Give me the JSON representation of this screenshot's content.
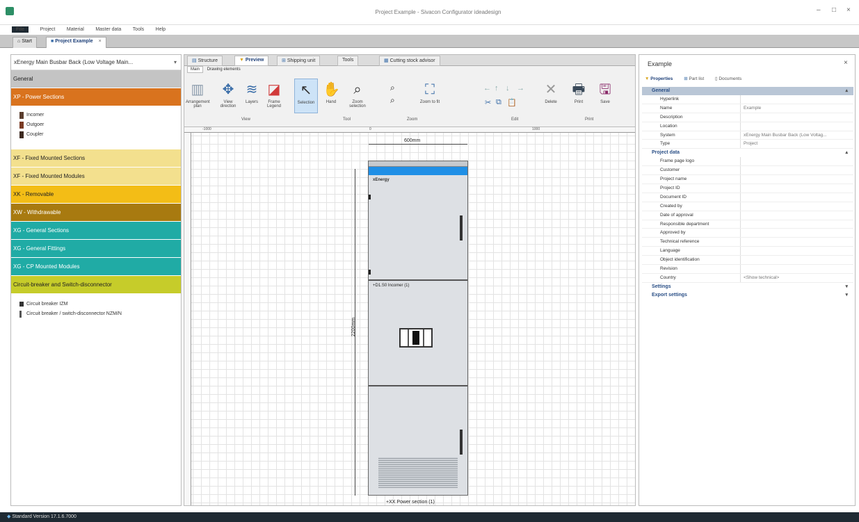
{
  "window": {
    "title": "Project Example - Sivacon Configurator ideadesign"
  },
  "menu": {
    "file": "File",
    "items": [
      "Project",
      "Material",
      "Master data",
      "Tools",
      "Help"
    ]
  },
  "tabs": {
    "start": "Start",
    "project": "Project Example"
  },
  "left": {
    "header": "xEnergy Main Busbar Back (Low Voltage Main...",
    "general": "General",
    "power_sections": "XP - Power Sections",
    "power_items": [
      "Incomer",
      "Outgoer",
      "Coupler"
    ],
    "groups": [
      {
        "label": "XF - Fixed Mounted Sections",
        "color": "#f3e08e"
      },
      {
        "label": "XF - Fixed Mounted Modules",
        "color": "#f3e08e"
      },
      {
        "label": "XK - Removable",
        "color": "#f3bd16"
      },
      {
        "label": "XW - Withdrawable",
        "color": "#a87a10"
      },
      {
        "label": "XG - General Sections",
        "color": "#20aba5"
      },
      {
        "label": "XG - General Fittings",
        "color": "#20aba5"
      },
      {
        "label": "XG - CP Mounted Modules",
        "color": "#20aba5"
      },
      {
        "label": "Circuit-breaker and Switch-disconnector",
        "color": "#c6cc2a"
      }
    ],
    "breaker_items": [
      "Circuit breaker IZM",
      "Circuit breaker / switch-disconnector NZM/N"
    ]
  },
  "center": {
    "tabs": [
      "Structure",
      "Preview",
      "Shipping unit",
      "Tools",
      "Cutting stock advisor"
    ],
    "subtabs": [
      "Main",
      "Drawing elements"
    ],
    "ribbon_buttons": [
      "Arrangement plan",
      "View direction",
      "Layers",
      "Frame Legend",
      "Selection",
      "Hand",
      "Zoom selection",
      "Zoom to fit",
      "Delete",
      "Print",
      "Save"
    ],
    "ribbon_groups": [
      "View",
      "Tool",
      "Zoom",
      "Edit",
      "Print"
    ],
    "width_label": "600mm",
    "height_label": "2200mm",
    "door_brand": "xEnergy",
    "incomer_label": "+D1.S0 Incomer (1)",
    "footer_label": "+XX Power section (1)",
    "ruler_marks": [
      "-1000",
      "0",
      "1000"
    ]
  },
  "right": {
    "title": "Example",
    "tabs": [
      "Properties",
      "Part list",
      "Documents"
    ],
    "general_title": "General",
    "general_rows": [
      {
        "key": "Hyperlink",
        "value": ""
      },
      {
        "key": "Name",
        "value": "Example"
      },
      {
        "key": "Description",
        "value": ""
      },
      {
        "key": "Location",
        "value": ""
      },
      {
        "key": "System",
        "value": "xEnergy Main Busbar Back (Low Voltag..."
      },
      {
        "key": "Type",
        "value": "Project"
      }
    ],
    "project_title": "Project data",
    "project_rows": [
      {
        "key": "Frame page logo",
        "value": ""
      },
      {
        "key": "Customer",
        "value": ""
      },
      {
        "key": "Project name",
        "value": ""
      },
      {
        "key": "Project ID",
        "value": ""
      },
      {
        "key": "Document ID",
        "value": ""
      },
      {
        "key": "Created by",
        "value": ""
      },
      {
        "key": "Date of approval",
        "value": ""
      },
      {
        "key": "Responsible department",
        "value": ""
      },
      {
        "key": "Approved by",
        "value": ""
      },
      {
        "key": "Technical reference",
        "value": ""
      },
      {
        "key": "Language",
        "value": ""
      },
      {
        "key": "Object identification",
        "value": ""
      },
      {
        "key": "Revision",
        "value": ""
      },
      {
        "key": "Country",
        "value": "<Show technical>"
      }
    ],
    "settings": "Settings",
    "export_settings": "Export settings"
  },
  "status": {
    "text": "Standard Version 17.1.6.7000"
  }
}
